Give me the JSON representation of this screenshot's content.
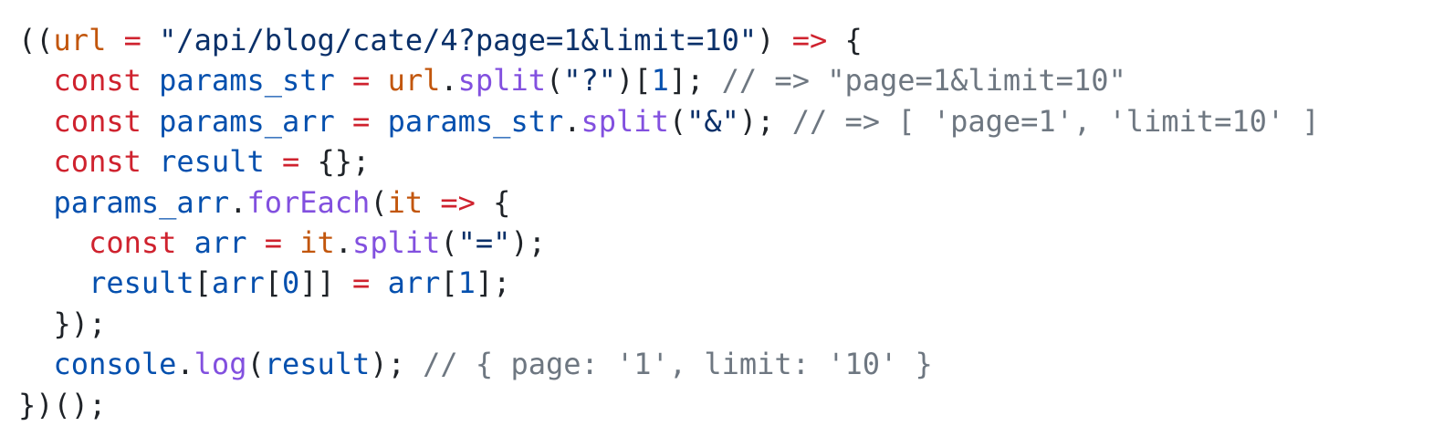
{
  "code": {
    "language": "javascript",
    "lines": [
      [
        {
          "t": "((",
          "c": "pun"
        },
        {
          "t": "url",
          "c": "prm"
        },
        {
          "t": " ",
          "c": "pun"
        },
        {
          "t": "=",
          "c": "op"
        },
        {
          "t": " ",
          "c": "pun"
        },
        {
          "t": "\"/api/blog/cate/4?page=1&limit=10\"",
          "c": "str"
        },
        {
          "t": ") ",
          "c": "pun"
        },
        {
          "t": "=>",
          "c": "op"
        },
        {
          "t": " {",
          "c": "pun"
        }
      ],
      [
        {
          "t": "  ",
          "c": "pun"
        },
        {
          "t": "const",
          "c": "kw"
        },
        {
          "t": " ",
          "c": "pun"
        },
        {
          "t": "params_str",
          "c": "var"
        },
        {
          "t": " ",
          "c": "pun"
        },
        {
          "t": "=",
          "c": "op"
        },
        {
          "t": " ",
          "c": "pun"
        },
        {
          "t": "url",
          "c": "prm"
        },
        {
          "t": ".",
          "c": "pun"
        },
        {
          "t": "split",
          "c": "fn"
        },
        {
          "t": "(",
          "c": "pun"
        },
        {
          "t": "\"?\"",
          "c": "str"
        },
        {
          "t": ")[",
          "c": "pun"
        },
        {
          "t": "1",
          "c": "num"
        },
        {
          "t": "]; ",
          "c": "pun"
        },
        {
          "t": "// => \"page=1&limit=10\"",
          "c": "cmt"
        }
      ],
      [
        {
          "t": "  ",
          "c": "pun"
        },
        {
          "t": "const",
          "c": "kw"
        },
        {
          "t": " ",
          "c": "pun"
        },
        {
          "t": "params_arr",
          "c": "var"
        },
        {
          "t": " ",
          "c": "pun"
        },
        {
          "t": "=",
          "c": "op"
        },
        {
          "t": " ",
          "c": "pun"
        },
        {
          "t": "params_str",
          "c": "var"
        },
        {
          "t": ".",
          "c": "pun"
        },
        {
          "t": "split",
          "c": "fn"
        },
        {
          "t": "(",
          "c": "pun"
        },
        {
          "t": "\"&\"",
          "c": "str"
        },
        {
          "t": "); ",
          "c": "pun"
        },
        {
          "t": "// => [ 'page=1', 'limit=10' ]",
          "c": "cmt"
        }
      ],
      [
        {
          "t": "  ",
          "c": "pun"
        },
        {
          "t": "const",
          "c": "kw"
        },
        {
          "t": " ",
          "c": "pun"
        },
        {
          "t": "result",
          "c": "var"
        },
        {
          "t": " ",
          "c": "pun"
        },
        {
          "t": "=",
          "c": "op"
        },
        {
          "t": " {};",
          "c": "pun"
        }
      ],
      [
        {
          "t": "  ",
          "c": "pun"
        },
        {
          "t": "params_arr",
          "c": "var"
        },
        {
          "t": ".",
          "c": "pun"
        },
        {
          "t": "forEach",
          "c": "fn"
        },
        {
          "t": "(",
          "c": "pun"
        },
        {
          "t": "it",
          "c": "prm"
        },
        {
          "t": " ",
          "c": "pun"
        },
        {
          "t": "=>",
          "c": "op"
        },
        {
          "t": " {",
          "c": "pun"
        }
      ],
      [
        {
          "t": "    ",
          "c": "pun"
        },
        {
          "t": "const",
          "c": "kw"
        },
        {
          "t": " ",
          "c": "pun"
        },
        {
          "t": "arr",
          "c": "var"
        },
        {
          "t": " ",
          "c": "pun"
        },
        {
          "t": "=",
          "c": "op"
        },
        {
          "t": " ",
          "c": "pun"
        },
        {
          "t": "it",
          "c": "prm"
        },
        {
          "t": ".",
          "c": "pun"
        },
        {
          "t": "split",
          "c": "fn"
        },
        {
          "t": "(",
          "c": "pun"
        },
        {
          "t": "\"=\"",
          "c": "str"
        },
        {
          "t": ");",
          "c": "pun"
        }
      ],
      [
        {
          "t": "    ",
          "c": "pun"
        },
        {
          "t": "result",
          "c": "var"
        },
        {
          "t": "[",
          "c": "pun"
        },
        {
          "t": "arr",
          "c": "var"
        },
        {
          "t": "[",
          "c": "pun"
        },
        {
          "t": "0",
          "c": "num"
        },
        {
          "t": "]] ",
          "c": "pun"
        },
        {
          "t": "=",
          "c": "op"
        },
        {
          "t": " ",
          "c": "pun"
        },
        {
          "t": "arr",
          "c": "var"
        },
        {
          "t": "[",
          "c": "pun"
        },
        {
          "t": "1",
          "c": "num"
        },
        {
          "t": "];",
          "c": "pun"
        }
      ],
      [
        {
          "t": "  });",
          "c": "pun"
        }
      ],
      [
        {
          "t": "  ",
          "c": "pun"
        },
        {
          "t": "console",
          "c": "var"
        },
        {
          "t": ".",
          "c": "pun"
        },
        {
          "t": "log",
          "c": "fn"
        },
        {
          "t": "(",
          "c": "pun"
        },
        {
          "t": "result",
          "c": "var"
        },
        {
          "t": "); ",
          "c": "pun"
        },
        {
          "t": "// { page: '1', limit: '10' }",
          "c": "cmt"
        }
      ],
      [
        {
          "t": "})();",
          "c": "pun"
        }
      ]
    ]
  }
}
